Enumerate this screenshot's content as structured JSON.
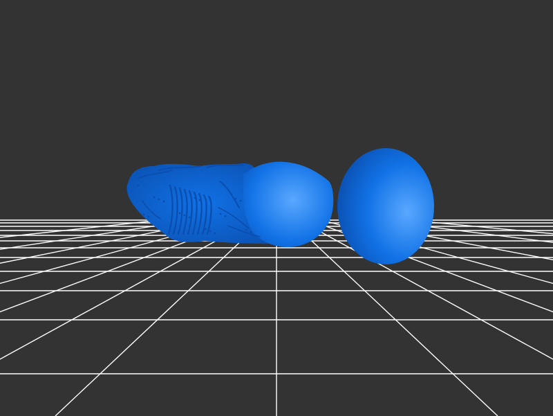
{
  "viewer": {
    "background_color": "#333333",
    "grid_color": "#ffffff",
    "model_color": "#1172e6",
    "model_shadow_color": "#0a4fb0",
    "model_highlight_color": "#5aa8ff",
    "grid_visible": true,
    "model_name": "3d-mesh-model"
  }
}
